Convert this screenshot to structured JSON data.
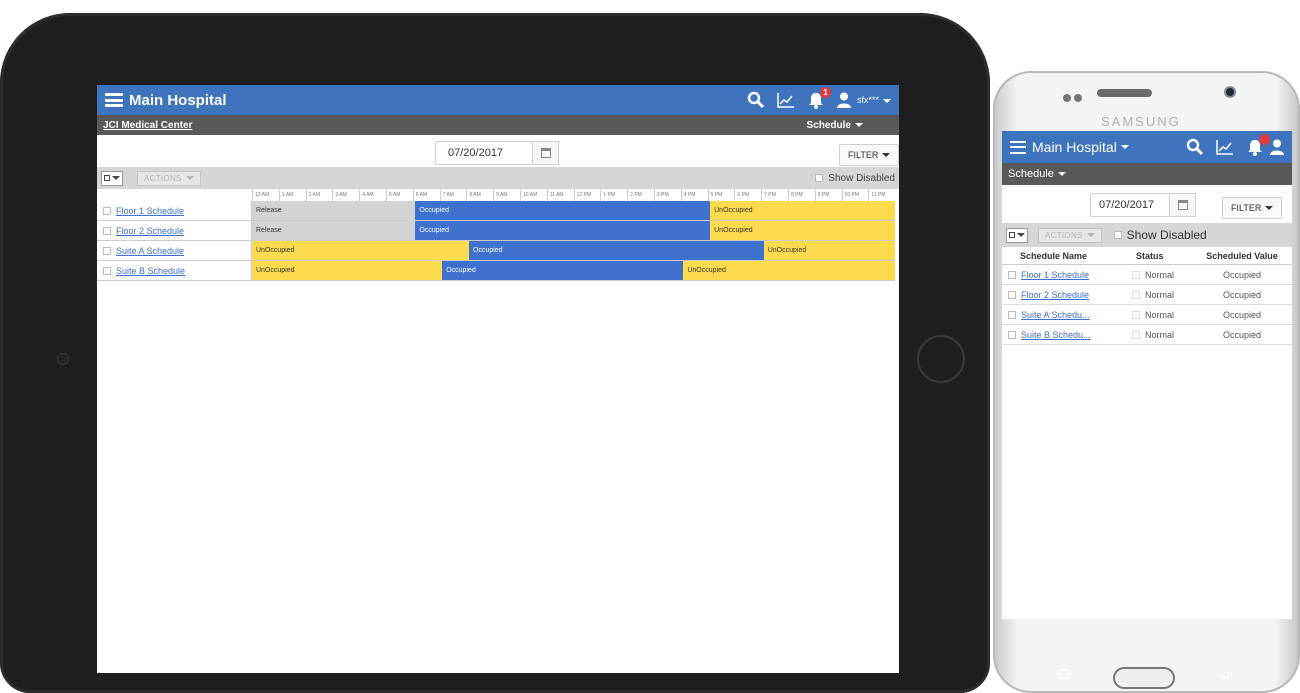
{
  "tablet": {
    "app_title": "Main Hospital",
    "user_label": "sfx***",
    "notification_count": "1",
    "site_name": "JCI Medical Center",
    "view_menu": "Schedule",
    "date": "07/20/2017",
    "filter_label": "FILTER",
    "actions_label": "ACTIONS",
    "show_disabled_label": "Show Disabled",
    "time_labels": [
      "12 AM",
      "1 AM",
      "2 AM",
      "3 AM",
      "4 AM",
      "5 AM",
      "6 AM",
      "7 AM",
      "8 AM",
      "9 AM",
      "10 AM",
      "11 AM",
      "12 PM",
      "1 PM",
      "2 PM",
      "3 PM",
      "4 PM",
      "5 PM",
      "6 PM",
      "7 PM",
      "8 PM",
      "9 PM",
      "10 PM",
      "11 PM"
    ],
    "schedules": [
      {
        "name": "Floor 1 Schedule",
        "segments": [
          {
            "state": "Release",
            "start": 0,
            "end": 6.1
          },
          {
            "state": "Occupied",
            "start": 6.1,
            "end": 17.1
          },
          {
            "state": "UnOccupied",
            "start": 17.1,
            "end": 24
          }
        ]
      },
      {
        "name": "Floor 2 Schedule",
        "segments": [
          {
            "state": "Release",
            "start": 0,
            "end": 6.1
          },
          {
            "state": "Occupied",
            "start": 6.1,
            "end": 17.1
          },
          {
            "state": "UnOccupied",
            "start": 17.1,
            "end": 24
          }
        ]
      },
      {
        "name": "Suite A Schedule",
        "segments": [
          {
            "state": "UnOccupied",
            "start": 0,
            "end": 8.1
          },
          {
            "state": "Occupied",
            "start": 8.1,
            "end": 19.1
          },
          {
            "state": "UnOccupied",
            "start": 19.1,
            "end": 24
          }
        ]
      },
      {
        "name": "Suite B Schedule",
        "segments": [
          {
            "state": "UnOccupied",
            "start": 0,
            "end": 7.1
          },
          {
            "state": "Occupied",
            "start": 7.1,
            "end": 16.1
          },
          {
            "state": "UnOccupied",
            "start": 16.1,
            "end": 24
          }
        ]
      }
    ]
  },
  "phone": {
    "brand": "SAMSUNG",
    "app_title": "Main Hospital",
    "view_menu": "Schedule",
    "date": "07/20/2017",
    "filter_label": "FILTER",
    "actions_label": "ACTIONS",
    "show_disabled_label": "Show Disabled",
    "columns": [
      "Schedule Name",
      "Status",
      "Scheduled Value"
    ],
    "rows": [
      {
        "name": "Floor 1 Schedule",
        "status": "Normal",
        "value": "Occupied"
      },
      {
        "name": "Floor 2 Schedule",
        "status": "Normal",
        "value": "Occupied"
      },
      {
        "name": "Suite A Schedu...",
        "status": "Normal",
        "value": "Occupied"
      },
      {
        "name": "Suite B Schedu...",
        "status": "Normal",
        "value": "Occupied"
      }
    ]
  },
  "colors": {
    "header_blue": "#3e74be",
    "occupied": "#3f71cf",
    "unoccupied": "#fddb4e",
    "release": "#d3d3d3"
  }
}
